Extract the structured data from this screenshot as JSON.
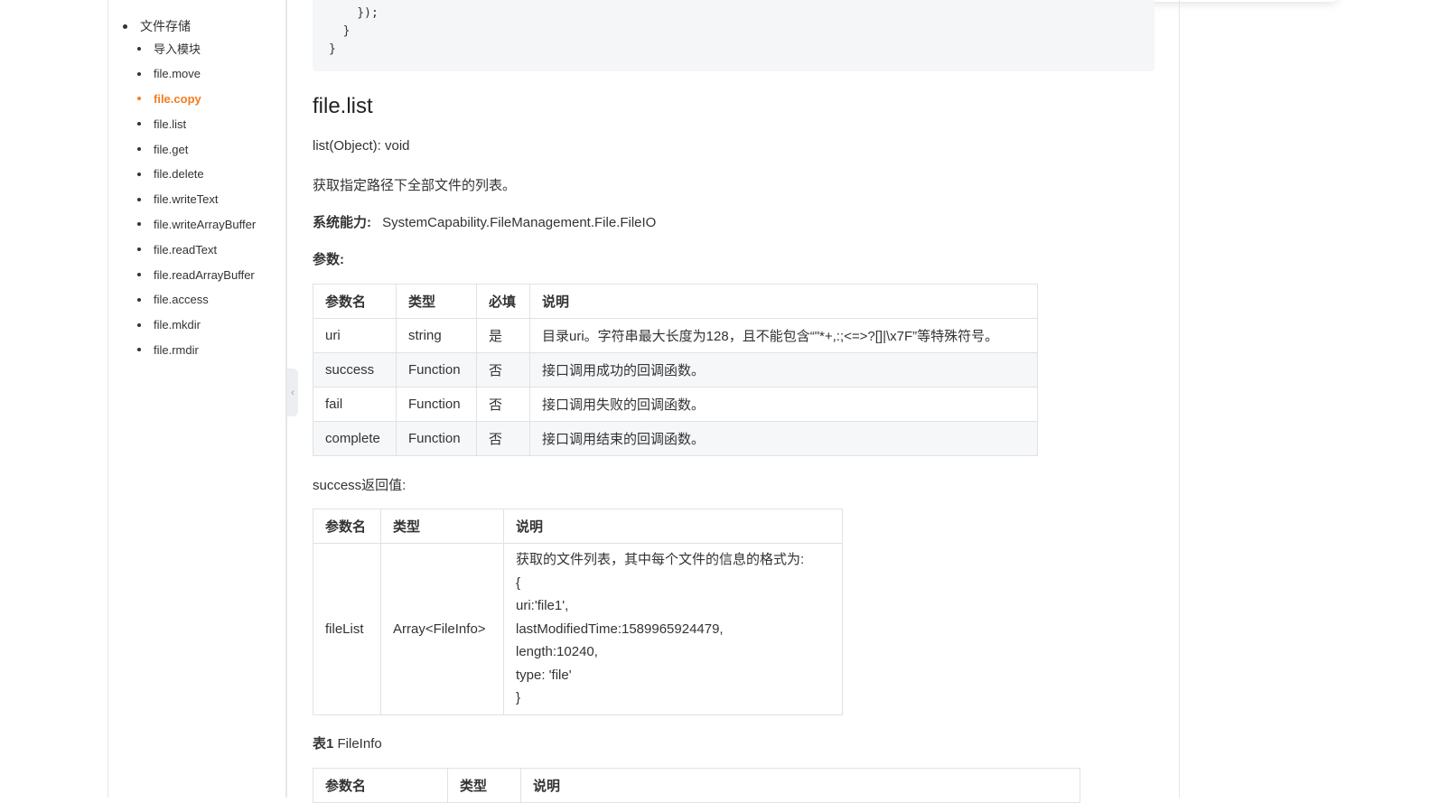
{
  "sidebar": {
    "section_label": "文件存储",
    "items": [
      {
        "label": "导入模块",
        "active": false
      },
      {
        "label": "file.move",
        "active": false
      },
      {
        "label": "file.copy",
        "active": true
      },
      {
        "label": "file.list",
        "active": false
      },
      {
        "label": "file.get",
        "active": false
      },
      {
        "label": "file.delete",
        "active": false
      },
      {
        "label": "file.writeText",
        "active": false
      },
      {
        "label": "file.writeArrayBuffer",
        "active": false
      },
      {
        "label": "file.readText",
        "active": false
      },
      {
        "label": "file.readArrayBuffer",
        "active": false
      },
      {
        "label": "file.access",
        "active": false
      },
      {
        "label": "file.mkdir",
        "active": false
      },
      {
        "label": "file.rmdir",
        "active": false
      }
    ],
    "accent_color": "#f47c20",
    "collapse_icon": "chevron-left-icon"
  },
  "code_tail": [
    "    });",
    "  }",
    "}"
  ],
  "doc": {
    "heading": "file.list",
    "signature": "list(Object): void",
    "description": "获取指定路径下全部文件的列表。",
    "capability_label": "系统能力:",
    "capability_value": "SystemCapability.FileManagement.File.FileIO",
    "params_label": "参数:",
    "params_table": {
      "headers": [
        "参数名",
        "类型",
        "必填",
        "说明"
      ],
      "rows": [
        [
          "uri",
          "string",
          "是",
          "目录uri。字符串最大长度为128，且不能包含“\"*+,:;<=>?[]|\\x7F”等特殊符号。"
        ],
        [
          "success",
          "Function",
          "否",
          "接口调用成功的回调函数。"
        ],
        [
          "fail",
          "Function",
          "否",
          "接口调用失败的回调函数。"
        ],
        [
          "complete",
          "Function",
          "否",
          "接口调用结束的回调函数。"
        ]
      ]
    },
    "success_label": "success返回值:",
    "success_table": {
      "headers": [
        "参数名",
        "类型",
        "说明"
      ],
      "row": {
        "name": "fileList",
        "type": "Array<FileInfo>",
        "desc_lines": [
          "获取的文件列表，其中每个文件的信息的格式为:",
          "{",
          "uri:'file1',",
          "lastModifiedTime:1589965924479,",
          "length:10240,",
          "type: 'file'",
          "}"
        ]
      }
    },
    "fileinfo_label_bold": "表1",
    "fileinfo_label_rest": " FileInfo",
    "fileinfo_table": {
      "headers": [
        "参数名",
        "类型",
        "说明"
      ]
    }
  }
}
